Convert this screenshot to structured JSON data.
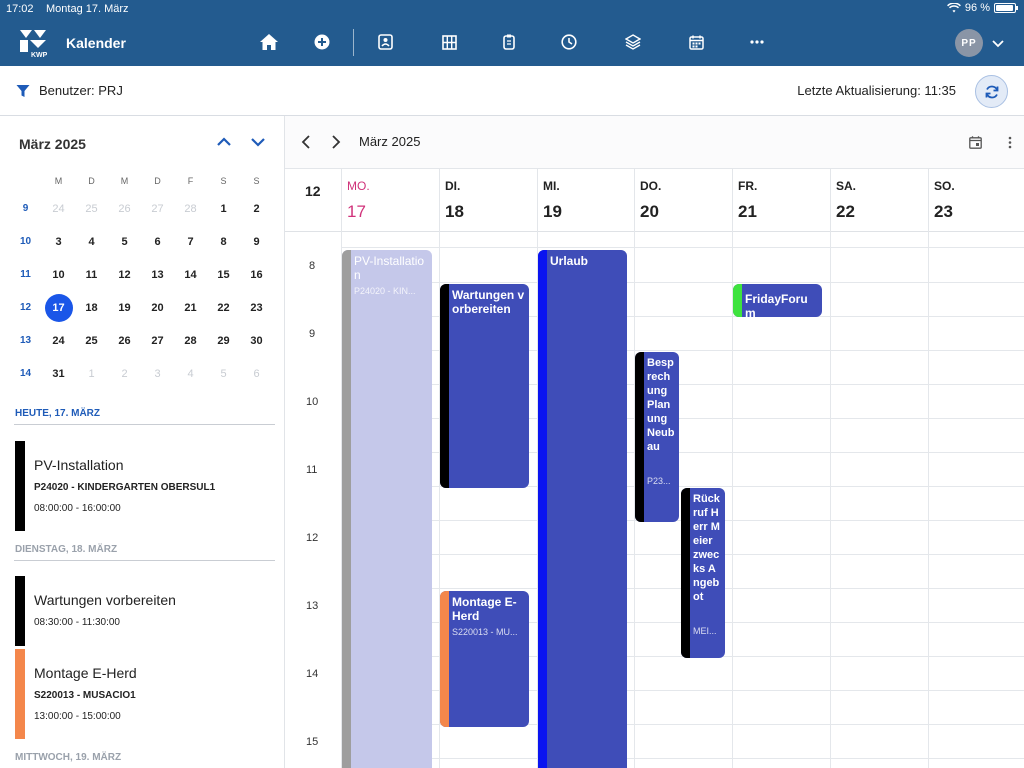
{
  "status": {
    "time": "17:02",
    "date": "Montag 17. März",
    "battery": "96 %"
  },
  "app": {
    "title": "Kalender"
  },
  "nav": {
    "icons": [
      "home-icon",
      "add-icon",
      "contacts-icon",
      "grid-icon",
      "clipboard-icon",
      "clock-icon",
      "layers-icon",
      "calendar-icon",
      "more-icon"
    ]
  },
  "user": {
    "initials": "PP"
  },
  "filter": {
    "label": "Benutzer: PRJ",
    "last_update": "Letzte Aktualisierung: 11:35"
  },
  "mini_calendar": {
    "title": "März 2025",
    "weekday_heads": [
      "M",
      "D",
      "M",
      "D",
      "F",
      "S",
      "S"
    ],
    "weeks": [
      {
        "week": "9",
        "days": [
          "24",
          "25",
          "26",
          "27",
          "28",
          "1",
          "2"
        ]
      },
      {
        "week": "10",
        "days": [
          "3",
          "4",
          "5",
          "6",
          "7",
          "8",
          "9"
        ]
      },
      {
        "week": "11",
        "days": [
          "10",
          "11",
          "12",
          "13",
          "14",
          "15",
          "16"
        ]
      },
      {
        "week": "12",
        "days": [
          "17",
          "18",
          "19",
          "20",
          "21",
          "22",
          "23"
        ]
      },
      {
        "week": "13",
        "days": [
          "24",
          "25",
          "26",
          "27",
          "28",
          "29",
          "30"
        ]
      },
      {
        "week": "14",
        "days": [
          "31",
          "1",
          "2",
          "3",
          "4",
          "5",
          "6"
        ]
      }
    ]
  },
  "agenda": {
    "heading_today": "HEUTE, 17. MÄRZ",
    "heading_tue": "DIENSTAG, 18. MÄRZ",
    "heading_wed": "MITTWOCH, 19. MÄRZ",
    "items": [
      {
        "title": "PV-Installation",
        "sub": "P24020 - KINDERGARTEN OBERSUL1",
        "time": "08:00:00 - 16:00:00",
        "color": "#000000"
      },
      {
        "title": "Wartungen vorbereiten",
        "sub": "",
        "time": "08:30:00 - 11:30:00",
        "color": "#000000"
      },
      {
        "title": "Montage E-Herd",
        "sub": "S220013 - MUSACIO1",
        "time": "13:00:00 - 15:00:00",
        "color": "#f4874b"
      }
    ]
  },
  "main": {
    "month": "März 2025",
    "week_number": "12",
    "days": [
      {
        "abbr": "MO.",
        "num": "17"
      },
      {
        "abbr": "DI.",
        "num": "18"
      },
      {
        "abbr": "MI.",
        "num": "19"
      },
      {
        "abbr": "DO.",
        "num": "20"
      },
      {
        "abbr": "FR.",
        "num": "21"
      },
      {
        "abbr": "SA.",
        "num": "22"
      },
      {
        "abbr": "SO.",
        "num": "23"
      }
    ],
    "hours": [
      "8",
      "9",
      "10",
      "11",
      "12",
      "13",
      "14",
      "15"
    ]
  },
  "events": {
    "pv": {
      "title": "PV-Installation",
      "sub": "P24020 - KIN...",
      "bar": "#9e9e9e",
      "bg": "#c5c8ea"
    },
    "wartungen": {
      "title": "Wartungen vorbereiten",
      "bar": "#000000",
      "bg": "#3f4db8"
    },
    "urlaub": {
      "title": "Urlaub",
      "bar": "#0a14f0",
      "bg": "#3f4db8"
    },
    "besprechung": {
      "title": "Besprechung Planung Neubau",
      "sub": "P23...",
      "bar": "#000000",
      "bg": "#3f4db8"
    },
    "rueckruf": {
      "title": "Rückruf Herr Meier zwecks Angebot",
      "sub": "MEI...",
      "bar": "#000000",
      "bg": "#3f4db8"
    },
    "montage": {
      "title": "Montage E-Herd",
      "sub": "S220013 - MU...",
      "bar": "#f4874b",
      "bg": "#3f4db8"
    },
    "friday": {
      "title": "FridayForum",
      "bar": "#3ee33e",
      "bg": "#3f4db8"
    }
  },
  "colors": {
    "header_bg": "#235b8f",
    "today": "#d0327a",
    "accent": "#1e5bb8",
    "selected_day": "#1a56e8"
  }
}
